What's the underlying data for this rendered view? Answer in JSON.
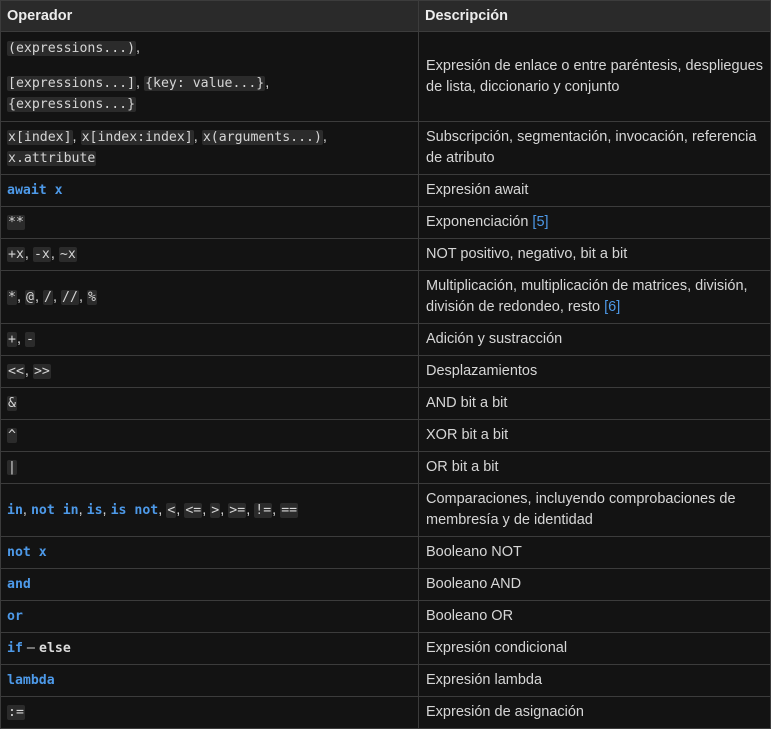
{
  "table": {
    "headers": {
      "operator": "Operador",
      "description": "Descripción"
    },
    "rows": [
      {
        "op": {
          "a": "(expressions...)",
          "b": "[expressions...]",
          "c": "{key: value...}",
          "d": "{expressions...}"
        },
        "desc": "Expresión de enlace o entre paréntesis, despliegues de lista, diccionario y conjunto"
      },
      {
        "op": {
          "a": "x[index]",
          "b": "x[index:index]",
          "c": "x(arguments...)",
          "d": "x.attribute"
        },
        "desc": "Subscripción, segmentación, invocación, referencia de atributo"
      },
      {
        "op": {
          "a": "await x"
        },
        "desc": "Expresión await"
      },
      {
        "op": {
          "a": "**"
        },
        "desc": "Exponenciación",
        "ref": "[5]"
      },
      {
        "op": {
          "a": "+x",
          "b": "-x",
          "c": "~x"
        },
        "desc": "NOT positivo, negativo, bit a bit"
      },
      {
        "op": {
          "a": "*",
          "b": "@",
          "c": "/",
          "d": "//",
          "e": "%"
        },
        "desc": "Multiplicación, multiplicación de matrices, división, división de redondeo, resto",
        "ref": "[6]"
      },
      {
        "op": {
          "a": "+",
          "b": "-"
        },
        "desc": "Adición y sustracción"
      },
      {
        "op": {
          "a": "<<",
          "b": ">>"
        },
        "desc": "Desplazamientos"
      },
      {
        "op": {
          "a": "&"
        },
        "desc": "AND bit a bit"
      },
      {
        "op": {
          "a": "^"
        },
        "desc": "XOR bit a bit"
      },
      {
        "op": {
          "a": "|"
        },
        "desc": "OR bit a bit"
      },
      {
        "op": {
          "a": "in",
          "b": "not in",
          "c": "is",
          "d": "is not",
          "e": "<",
          "f": "<=",
          "g": ">",
          "h": ">=",
          "i": "!=",
          "j": "=="
        },
        "desc": "Comparaciones, incluyendo comprobaciones de membresía y de identidad"
      },
      {
        "op": {
          "a": "not x"
        },
        "desc": "Booleano NOT"
      },
      {
        "op": {
          "a": "and"
        },
        "desc": "Booleano AND"
      },
      {
        "op": {
          "a": "or"
        },
        "desc": "Booleano OR"
      },
      {
        "op": {
          "a": "if",
          "sep": " – ",
          "b": "else"
        },
        "desc": "Expresión condicional"
      },
      {
        "op": {
          "a": "lambda"
        },
        "desc": "Expresión lambda"
      },
      {
        "op": {
          "a": ":="
        },
        "desc": "Expresión de asignación"
      }
    ]
  }
}
